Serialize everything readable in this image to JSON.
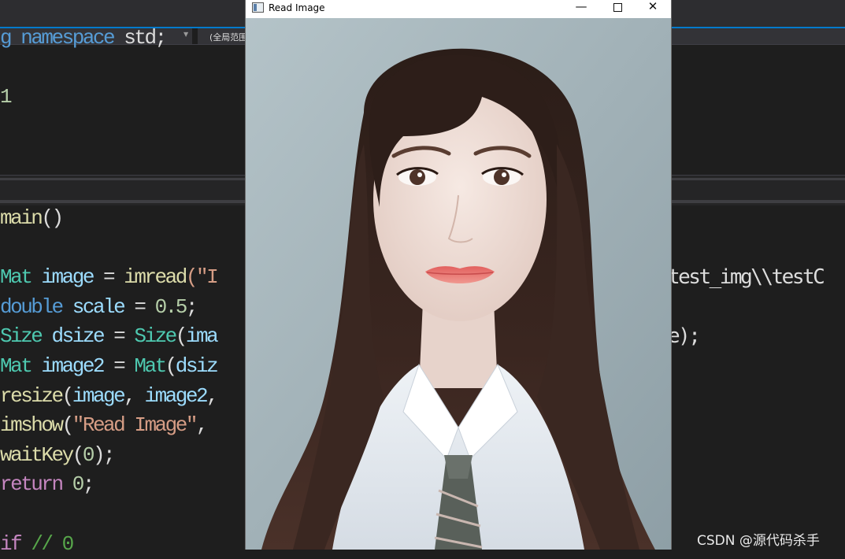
{
  "ide": {
    "scope_label": "(全局范围)",
    "code_lines_top": [
      [
        {
          "t": "g ",
          "c": "kw"
        },
        {
          "t": "namespace",
          "c": "kw"
        },
        {
          "t": " std;",
          "c": ""
        }
      ],
      [
        {
          "t": "",
          "c": ""
        }
      ],
      [
        {
          "t": "1",
          "c": "nm"
        }
      ]
    ],
    "code_lines_main": [
      [
        {
          "t": "main",
          "c": "fn"
        },
        {
          "t": "()",
          "c": ""
        }
      ],
      [
        {
          "t": "",
          "c": ""
        }
      ],
      [
        {
          "t": "Mat",
          "c": "ty"
        },
        {
          "t": " ",
          "c": ""
        },
        {
          "t": "image",
          "c": "vr"
        },
        {
          "t": " = ",
          "c": ""
        },
        {
          "t": "imread",
          "c": "fn"
        },
        {
          "t": "(\"I",
          "c": "st"
        }
      ],
      [
        {
          "t": "double",
          "c": "kw"
        },
        {
          "t": " ",
          "c": ""
        },
        {
          "t": "scale",
          "c": "vr"
        },
        {
          "t": " = ",
          "c": ""
        },
        {
          "t": "0.5",
          "c": "nm"
        },
        {
          "t": ";",
          "c": ""
        }
      ],
      [
        {
          "t": "Size",
          "c": "ty"
        },
        {
          "t": " ",
          "c": ""
        },
        {
          "t": "dsize",
          "c": "vr"
        },
        {
          "t": " = ",
          "c": ""
        },
        {
          "t": "Size",
          "c": "ty"
        },
        {
          "t": "(",
          "c": ""
        },
        {
          "t": "ima",
          "c": "vr"
        }
      ],
      [
        {
          "t": "Mat",
          "c": "ty"
        },
        {
          "t": " ",
          "c": ""
        },
        {
          "t": "image2",
          "c": "vr"
        },
        {
          "t": " = ",
          "c": ""
        },
        {
          "t": "Mat",
          "c": "ty"
        },
        {
          "t": "(",
          "c": ""
        },
        {
          "t": "dsiz",
          "c": "vr"
        }
      ],
      [
        {
          "t": "resize",
          "c": "fn"
        },
        {
          "t": "(",
          "c": ""
        },
        {
          "t": "image",
          "c": "vr"
        },
        {
          "t": ", ",
          "c": ""
        },
        {
          "t": "image2",
          "c": "vr"
        },
        {
          "t": ",",
          "c": ""
        }
      ],
      [
        {
          "t": "imshow",
          "c": "fn"
        },
        {
          "t": "(",
          "c": ""
        },
        {
          "t": "\"Read Image\"",
          "c": "st"
        },
        {
          "t": ",",
          "c": ""
        }
      ],
      [
        {
          "t": "waitKey",
          "c": "fn"
        },
        {
          "t": "(",
          "c": ""
        },
        {
          "t": "0",
          "c": "nm"
        },
        {
          "t": ");",
          "c": ""
        }
      ],
      [
        {
          "t": "return",
          "c": "pp"
        },
        {
          "t": " ",
          "c": ""
        },
        {
          "t": "0",
          "c": "nm"
        },
        {
          "t": ";",
          "c": ""
        }
      ],
      [
        {
          "t": "",
          "c": ""
        }
      ],
      [
        {
          "t": "if",
          "c": "pp"
        },
        {
          "t": " ",
          "c": ""
        },
        {
          "t": "// 0",
          "c": "cm"
        }
      ]
    ],
    "right_fragments": {
      "line_imread": "test_img\\\\testC",
      "line_size": "e);"
    }
  },
  "window": {
    "title": "Read Image",
    "min_icon": "minimize-icon",
    "max_icon": "maximize-icon",
    "close_icon": "close-icon",
    "close_glyph": "✕",
    "min_glyph": "—"
  },
  "watermark": "CSDN @源代码杀手",
  "colors": {
    "editor_bg": "#1e1e1e",
    "accent": "#007acc",
    "keyword": "#569cd6",
    "type": "#4ec9b0",
    "function": "#dcdcaa",
    "variable": "#9cdcfe",
    "string": "#d69d85",
    "number": "#b5cea8",
    "comment": "#57a64a",
    "control": "#c586c0"
  }
}
